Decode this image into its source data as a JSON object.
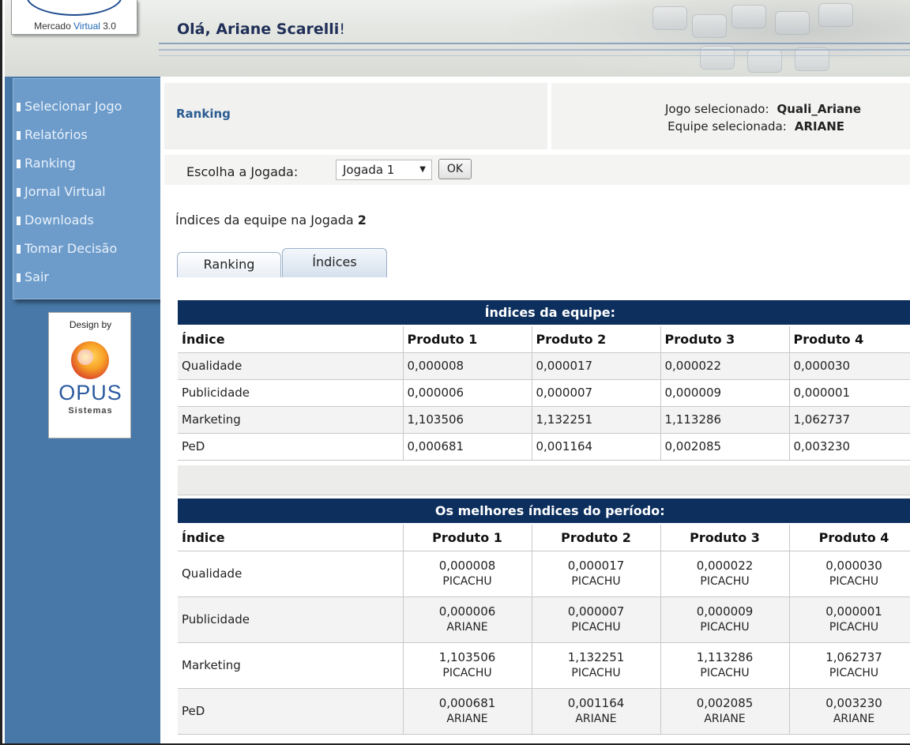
{
  "header": {
    "logo": {
      "brand_prefix": "Mercado ",
      "brand_v": "Virtual",
      "brand_version": " 3.0"
    },
    "greeting": "Olá, Ariane Scarelli",
    "greeting_suffix": "!"
  },
  "sidebar": {
    "items": [
      {
        "label": "Selecionar Jogo"
      },
      {
        "label": "Relatórios"
      },
      {
        "label": "Ranking"
      },
      {
        "label": "Jornal Virtual"
      },
      {
        "label": "Downloads"
      },
      {
        "label": "Tomar Decisão"
      },
      {
        "label": "Sair"
      }
    ],
    "design_by": "Design by",
    "opus_name": "OPUS",
    "opus_sub": "Sistemas"
  },
  "page": {
    "title": "Ranking",
    "jogo_label": "Jogo selecionado:",
    "jogo_value": "Quali_Ariane",
    "equipe_label": "Equipe selecionada:",
    "equipe_value": "ARIANE"
  },
  "choose": {
    "label": "Escolha a Jogada:",
    "selected": "Jogada 1",
    "ok": "OK"
  },
  "indices_line": {
    "text": "Índices da equipe na Jogada ",
    "num": "2"
  },
  "tabs": [
    {
      "label": "Ranking"
    },
    {
      "label": "Índices"
    }
  ],
  "team_table": {
    "title": "Índices da equipe:",
    "headers": [
      "Índice",
      "Produto 1",
      "Produto 2",
      "Produto 3",
      "Produto 4"
    ],
    "rows": [
      [
        "Qualidade",
        "0,000008",
        "0,000017",
        "0,000022",
        "0,000030"
      ],
      [
        "Publicidade",
        "0,000006",
        "0,000007",
        "0,000009",
        "0,000001"
      ],
      [
        "Marketing",
        "1,103506",
        "1,132251",
        "1,113286",
        "1,062737"
      ],
      [
        "PeD",
        "0,000681",
        "0,001164",
        "0,002085",
        "0,003230"
      ]
    ]
  },
  "best_table": {
    "title": "Os melhores índices do período:",
    "headers": [
      "Índice",
      "Produto 1",
      "Produto 2",
      "Produto 3",
      "Produto 4"
    ],
    "rows": [
      {
        "index": "Qualidade",
        "cells": [
          {
            "value": "0,000008",
            "team": "PICACHU"
          },
          {
            "value": "0,000017",
            "team": "PICACHU"
          },
          {
            "value": "0,000022",
            "team": "PICACHU"
          },
          {
            "value": "0,000030",
            "team": "PICACHU"
          }
        ]
      },
      {
        "index": "Publicidade",
        "cells": [
          {
            "value": "0,000006",
            "team": "ARIANE"
          },
          {
            "value": "0,000007",
            "team": "PICACHU"
          },
          {
            "value": "0,000009",
            "team": "PICACHU"
          },
          {
            "value": "0,000001",
            "team": "PICACHU"
          }
        ]
      },
      {
        "index": "Marketing",
        "cells": [
          {
            "value": "1,103506",
            "team": "PICACHU"
          },
          {
            "value": "1,132251",
            "team": "PICACHU"
          },
          {
            "value": "1,113286",
            "team": "PICACHU"
          },
          {
            "value": "1,062737",
            "team": "PICACHU"
          }
        ]
      },
      {
        "index": "PeD",
        "cells": [
          {
            "value": "0,000681",
            "team": "ARIANE"
          },
          {
            "value": "0,001164",
            "team": "ARIANE"
          },
          {
            "value": "0,002085",
            "team": "ARIANE"
          },
          {
            "value": "0,003230",
            "team": "ARIANE"
          }
        ]
      }
    ]
  },
  "colors": {
    "sidebar": "#4878a8",
    "menu": "#6d9ccb",
    "table_title": "#0c2f5e",
    "title_link": "#2b5c91"
  }
}
